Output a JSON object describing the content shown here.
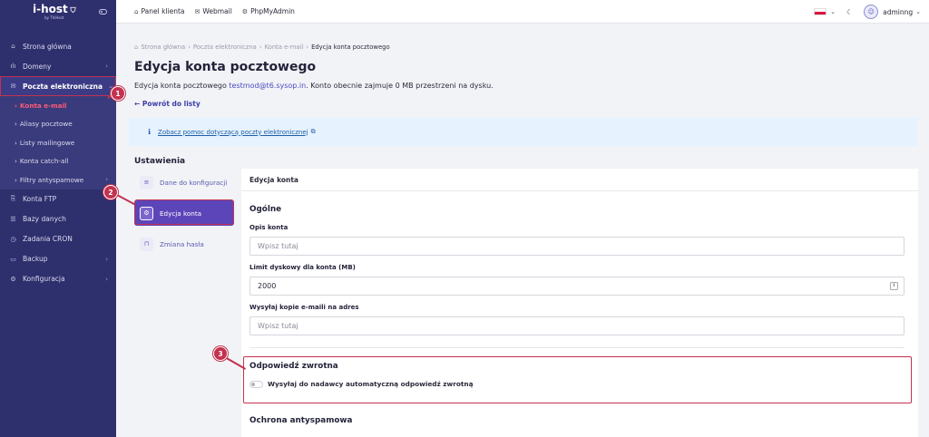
{
  "brand": {
    "name": "i-host",
    "sub": "by ThiHost"
  },
  "topbar": {
    "links": [
      {
        "label": "Panel klienta",
        "icon": "home-icon"
      },
      {
        "label": "Webmail",
        "icon": "mail-icon"
      },
      {
        "label": "PhpMyAdmin",
        "icon": "database-gear-icon"
      }
    ],
    "user": "adminng"
  },
  "sidebar": {
    "items": [
      {
        "label": "Strona główna",
        "icon": "home-icon"
      },
      {
        "label": "Domeny",
        "icon": "domains-icon"
      },
      {
        "label": "Poczta elektroniczna",
        "icon": "mail-icon"
      },
      {
        "label": "Konta FTP",
        "icon": "ftp-icon"
      },
      {
        "label": "Bazy danych",
        "icon": "database-icon"
      },
      {
        "label": "Zadania CRON",
        "icon": "clock-icon"
      },
      {
        "label": "Backup",
        "icon": "backup-icon"
      },
      {
        "label": "Konfiguracja",
        "icon": "gear-icon"
      }
    ],
    "mail_sub": [
      {
        "label": "Konta e-mail"
      },
      {
        "label": "Aliasy pocztowe"
      },
      {
        "label": "Listy mailingowe"
      },
      {
        "label": "Konta catch-all"
      },
      {
        "label": "Filtry antyspamowe"
      }
    ]
  },
  "breadcrumb": [
    "Strona główna",
    "Poczta elektroniczna",
    "Konta e-mail",
    "Edycja konta pocztowego"
  ],
  "page": {
    "title": "Edycja konta pocztowego",
    "desc_prefix": "Edycja konta pocztowego ",
    "desc_email": "testmod@t6.sysop.in",
    "desc_suffix": ". Konto obecnie zajmuje 0 MB przestrzeni na dysku.",
    "back": "← Powrót do listy",
    "info_link": "Zobacz pomoc dotyczącą poczty elektronicznej",
    "settings_title": "Ustawienia"
  },
  "tabs": [
    {
      "label": "Dane do konfiguracji",
      "icon": "list-icon"
    },
    {
      "label": "Edycja konta",
      "icon": "gear-icon"
    },
    {
      "label": "Zmiana hasła",
      "icon": "lock-icon"
    }
  ],
  "panel": {
    "header": "Edycja konta",
    "general_title": "Ogólne",
    "desc_label": "Opis konta",
    "desc_placeholder": "Wpisz tutaj",
    "limit_label": "Limit dyskowy dla konta (MB)",
    "limit_value": "2000",
    "copy_label": "Wysyłaj kopie e-maili na adres",
    "copy_placeholder": "Wpisz tutaj",
    "autoreply_title": "Odpowiedź zwrotna",
    "autoreply_toggle": "Wysyłaj do nadawcy automatyczną odpowiedź zwrotną",
    "antispam_title": "Ochrona antyspamowa"
  },
  "markers": [
    "1",
    "2",
    "3"
  ],
  "colors": {
    "sidebar": "#2e2f6d",
    "accent": "#5c45b8",
    "highlight": "#c2324f",
    "link": "#4a4ac0"
  }
}
